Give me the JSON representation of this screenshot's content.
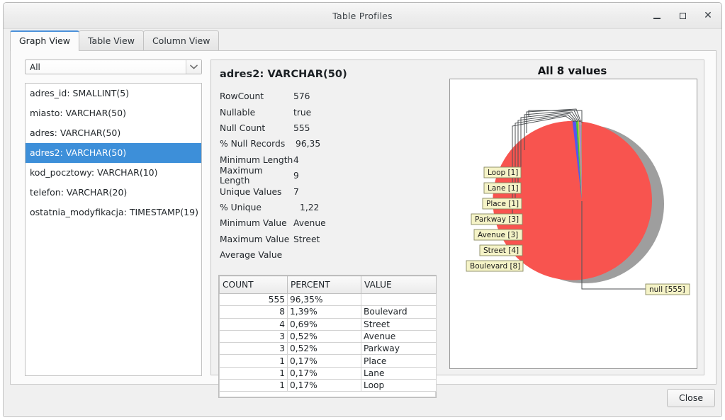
{
  "window": {
    "title": "Table Profiles",
    "minimize_label": "Minimize",
    "maximize_label": "Maximize",
    "close_label": "Close"
  },
  "tabs": [
    {
      "label": "Graph View",
      "active": true
    },
    {
      "label": "Table View",
      "active": false
    },
    {
      "label": "Column View",
      "active": false
    }
  ],
  "filter": {
    "selected": "All",
    "options": [
      "All"
    ]
  },
  "columns": [
    {
      "label": "adres_id: SMALLINT(5)",
      "selected": false
    },
    {
      "label": "miasto: VARCHAR(50)",
      "selected": false
    },
    {
      "label": "adres: VARCHAR(50)",
      "selected": false
    },
    {
      "label": "adres2: VARCHAR(50)",
      "selected": true
    },
    {
      "label": "kod_pocztowy: VARCHAR(10)",
      "selected": false
    },
    {
      "label": "telefon: VARCHAR(20)",
      "selected": false
    },
    {
      "label": "ostatnia_modyfikacja: TIMESTAMP(19)",
      "selected": false
    }
  ],
  "detail": {
    "title": "adres2: VARCHAR(50)",
    "stats": [
      {
        "label": "RowCount",
        "value": "576"
      },
      {
        "label": "Nullable",
        "value": "true"
      },
      {
        "label": "Null Count",
        "value": "555"
      },
      {
        "label": "% Null Records",
        "value": "96,35"
      },
      {
        "label": "Minimum Length",
        "value": "4"
      },
      {
        "label": "Maximum Length",
        "value": "9"
      },
      {
        "label": "Unique Values",
        "value": "7"
      },
      {
        "label": "% Unique",
        "value": "1,22"
      },
      {
        "label": "Minimum Value",
        "value": "Avenue"
      },
      {
        "label": "Maximum Value",
        "value": "Street"
      },
      {
        "label": "Average Value",
        "value": ""
      }
    ]
  },
  "value_table": {
    "headers": [
      "COUNT",
      "PERCENT",
      "VALUE"
    ],
    "rows": [
      {
        "count": "555",
        "percent": "96,35%",
        "value": ""
      },
      {
        "count": "8",
        "percent": "1,39%",
        "value": "Boulevard"
      },
      {
        "count": "4",
        "percent": "0,69%",
        "value": "Street"
      },
      {
        "count": "3",
        "percent": "0,52%",
        "value": "Avenue"
      },
      {
        "count": "3",
        "percent": "0,52%",
        "value": "Parkway"
      },
      {
        "count": "1",
        "percent": "0,17%",
        "value": "Place"
      },
      {
        "count": "1",
        "percent": "0,17%",
        "value": "Lane"
      },
      {
        "count": "1",
        "percent": "0,17%",
        "value": "Loop"
      }
    ]
  },
  "chart_data": {
    "type": "pie",
    "title": "All 8 values",
    "labels": [
      "null",
      "Boulevard",
      "Street",
      "Avenue",
      "Parkway",
      "Place",
      "Lane",
      "Loop"
    ],
    "values": [
      555,
      8,
      4,
      3,
      3,
      1,
      1,
      1
    ],
    "annotations": [
      "null [555]",
      "Boulevard [8]",
      "Street [4]",
      "Avenue [3]",
      "Parkway [3]",
      "Place [1]",
      "Lane [1]",
      "Loop [1]"
    ],
    "colors": [
      "#f8544f",
      "#5555f0",
      "#3ec03e",
      "#c9c93a",
      "#b06fd0",
      "#8fd4e0",
      "#e08a50",
      "#909090"
    ],
    "legend": "labels-with-leader-lines",
    "total": 576
  },
  "footer": {
    "close_label": "Close"
  }
}
